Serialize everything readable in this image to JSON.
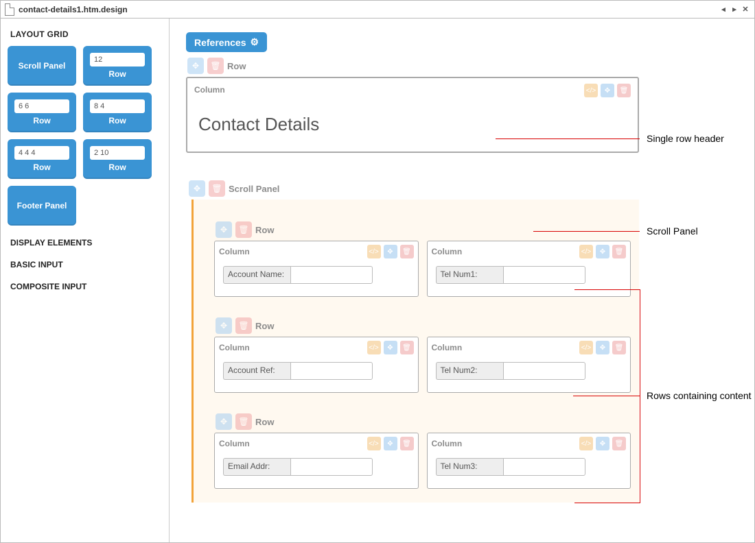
{
  "title": "contact-details1.htm.design",
  "sidebar": {
    "section_layout": "LAYOUT GRID",
    "scroll_panel": "Scroll Panel",
    "rows": [
      {
        "val": "12",
        "label": "Row"
      },
      {
        "val": "6 6",
        "label": "Row"
      },
      {
        "val": "8 4",
        "label": "Row"
      },
      {
        "val": "4 4 4",
        "label": "Row"
      },
      {
        "val": "2 10",
        "label": "Row"
      }
    ],
    "footer_panel": "Footer Panel",
    "section_display": "DISPLAY ELEMENTS",
    "section_basic": "BASIC INPUT",
    "section_composite": "COMPOSITE INPUT"
  },
  "references_label": "References",
  "labels": {
    "row": "Row",
    "column": "Column",
    "scroll_panel": "Scroll Panel"
  },
  "header_title": "Contact Details",
  "fields": {
    "r1c1": "Account Name:",
    "r1c2": "Tel Num1:",
    "r2c1": "Account Ref:",
    "r2c2": "Tel Num2:",
    "r3c1": "Email Addr:",
    "r3c2": "Tel Num3:"
  },
  "annotations": {
    "a1": "Single row header",
    "a2": "Scroll Panel",
    "a3": "Rows containing content"
  }
}
